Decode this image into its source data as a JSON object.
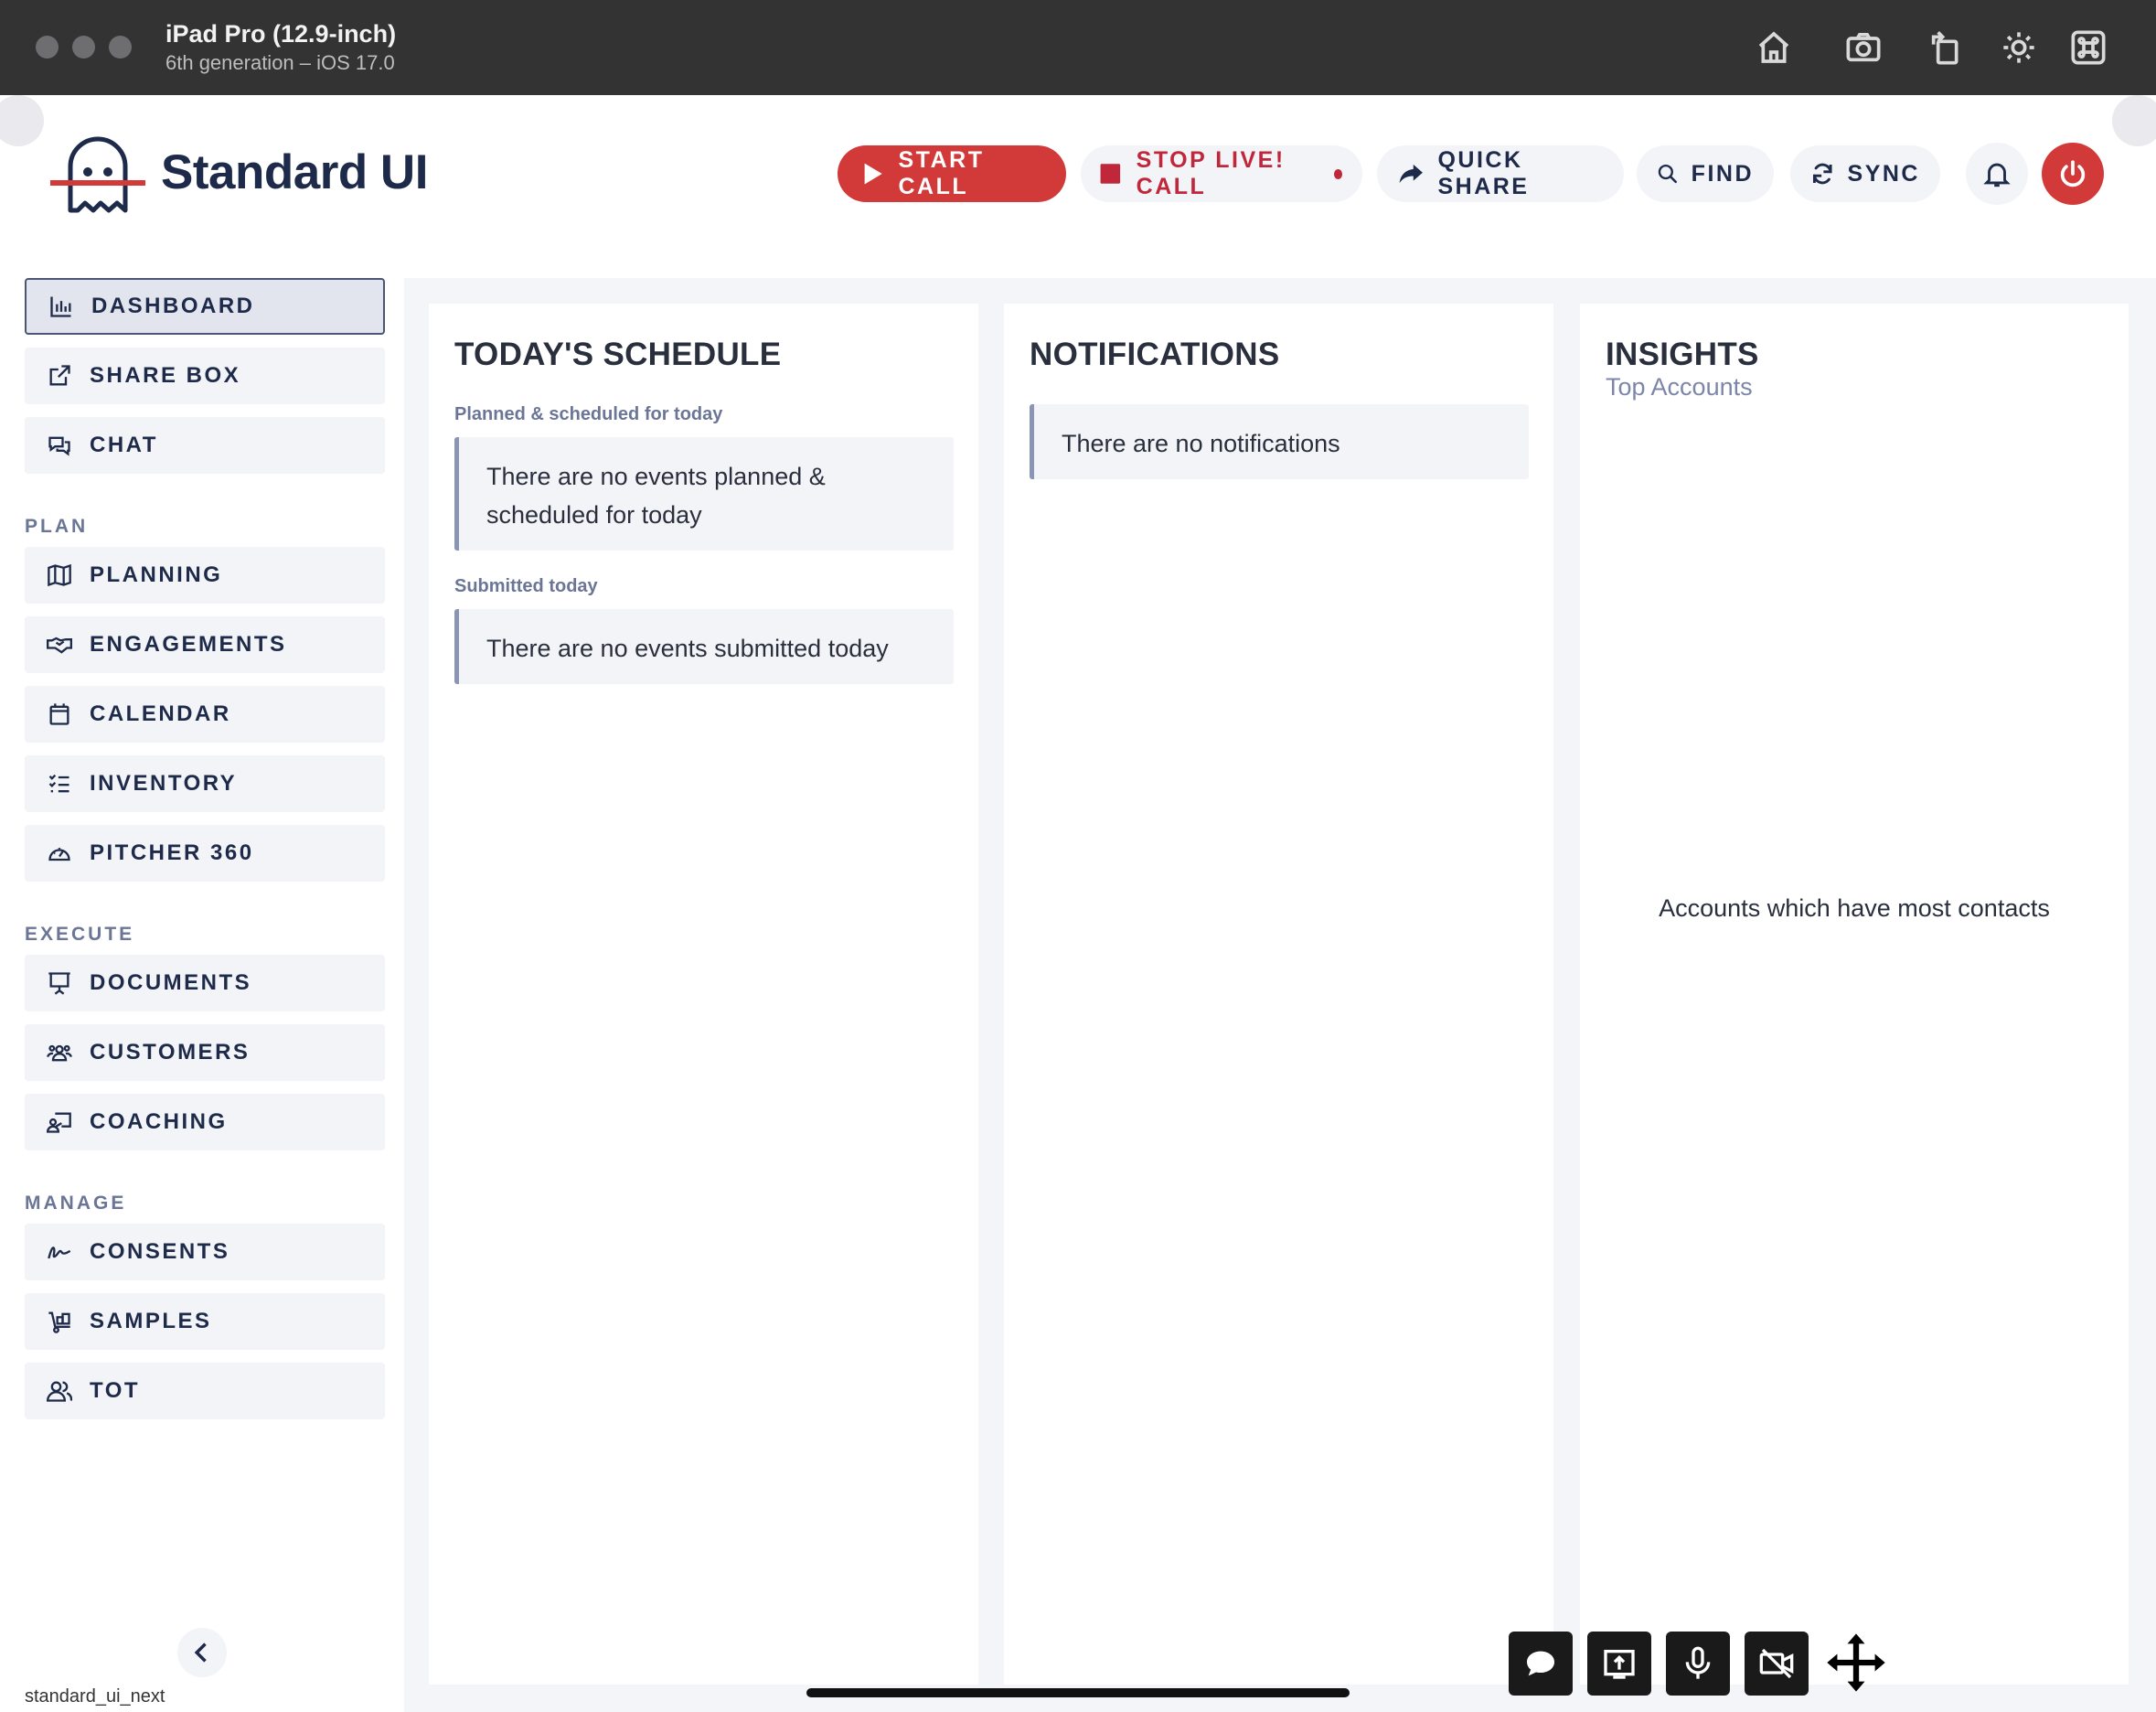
{
  "simulator": {
    "device": "iPad Pro (12.9-inch)",
    "subtitle": "6th generation – iOS 17.0",
    "icons": [
      "home-icon",
      "screenshot-icon",
      "rotate-icon",
      "brightness-icon",
      "command-icon"
    ]
  },
  "header": {
    "brand": "Standard UI",
    "buttons": {
      "start_call": "START CALL",
      "stop_live_call": "STOP LIVE! CALL",
      "quick_share": "QUICK SHARE",
      "find": "FIND",
      "sync": "SYNC"
    },
    "colors": {
      "accent_red": "#d23a3a",
      "navy": "#1e2a4a"
    }
  },
  "sidebar": {
    "top_items": [
      {
        "label": "DASHBOARD",
        "icon": "bar-chart-icon",
        "active": true
      },
      {
        "label": "SHARE BOX",
        "icon": "external-link-icon"
      },
      {
        "label": "CHAT",
        "icon": "chat-bubbles-icon"
      }
    ],
    "sections": [
      {
        "title": "PLAN",
        "items": [
          {
            "label": "PLANNING",
            "icon": "map-icon"
          },
          {
            "label": "ENGAGEMENTS",
            "icon": "handshake-icon"
          },
          {
            "label": "CALENDAR",
            "icon": "calendar-icon"
          },
          {
            "label": "INVENTORY",
            "icon": "list-check-icon"
          },
          {
            "label": "PITCHER 360",
            "icon": "gauge-icon"
          }
        ]
      },
      {
        "title": "EXECUTE",
        "items": [
          {
            "label": "DOCUMENTS",
            "icon": "presentation-icon"
          },
          {
            "label": "CUSTOMERS",
            "icon": "users-icon"
          },
          {
            "label": "COACHING",
            "icon": "chalkboard-teacher-icon"
          }
        ]
      },
      {
        "title": "MANAGE",
        "items": [
          {
            "label": "CONSENTS",
            "icon": "signature-icon"
          },
          {
            "label": "SAMPLES",
            "icon": "dolly-icon"
          },
          {
            "label": "TOT",
            "icon": "user-group-icon"
          }
        ]
      }
    ],
    "footer_version": "standard_ui_next"
  },
  "main": {
    "schedule": {
      "title": "TODAY'S SCHEDULE",
      "planned_label": "Planned & scheduled for today",
      "planned_empty": "There are no events planned & scheduled for today",
      "submitted_label": "Submitted today",
      "submitted_empty": "There are no events submitted today"
    },
    "notifications": {
      "title": "NOTIFICATIONS",
      "empty": "There are no notifications"
    },
    "insights": {
      "title": "INSIGHTS",
      "subtitle": "Top Accounts",
      "placeholder": "Accounts which have most contacts"
    }
  },
  "call_controls": [
    "chat-icon",
    "share-screen-icon",
    "microphone-icon",
    "video-off-icon",
    "move-icon"
  ]
}
